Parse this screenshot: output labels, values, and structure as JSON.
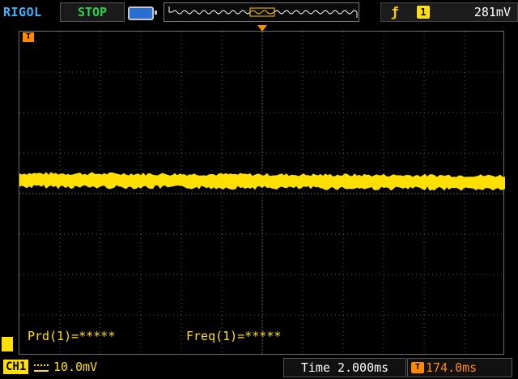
{
  "header": {
    "brand": "RIGOL",
    "run_state": "STOP",
    "trigger": {
      "edge_icon": "rising-edge-icon",
      "source": "1",
      "level": "281mV"
    }
  },
  "display": {
    "grid_divisions": {
      "horizontal": 12,
      "vertical": 8
    },
    "trace": {
      "channel": "CH1",
      "color": "#ffe000"
    }
  },
  "measurements": {
    "period": "Prd(1)=*****",
    "frequency": "Freq(1)=*****"
  },
  "footer": {
    "channel_label": "CH1",
    "coupling_icon": "dc-coupling-icon",
    "volts_per_div": "10.0mV",
    "time_base": "Time 2.000ms",
    "trigger_offset": "174.0ms"
  },
  "colors": {
    "ch1": "#ffe000",
    "trigger": "#ff8a00",
    "brand": "#3fb4ff",
    "stop": "#29d04a"
  }
}
